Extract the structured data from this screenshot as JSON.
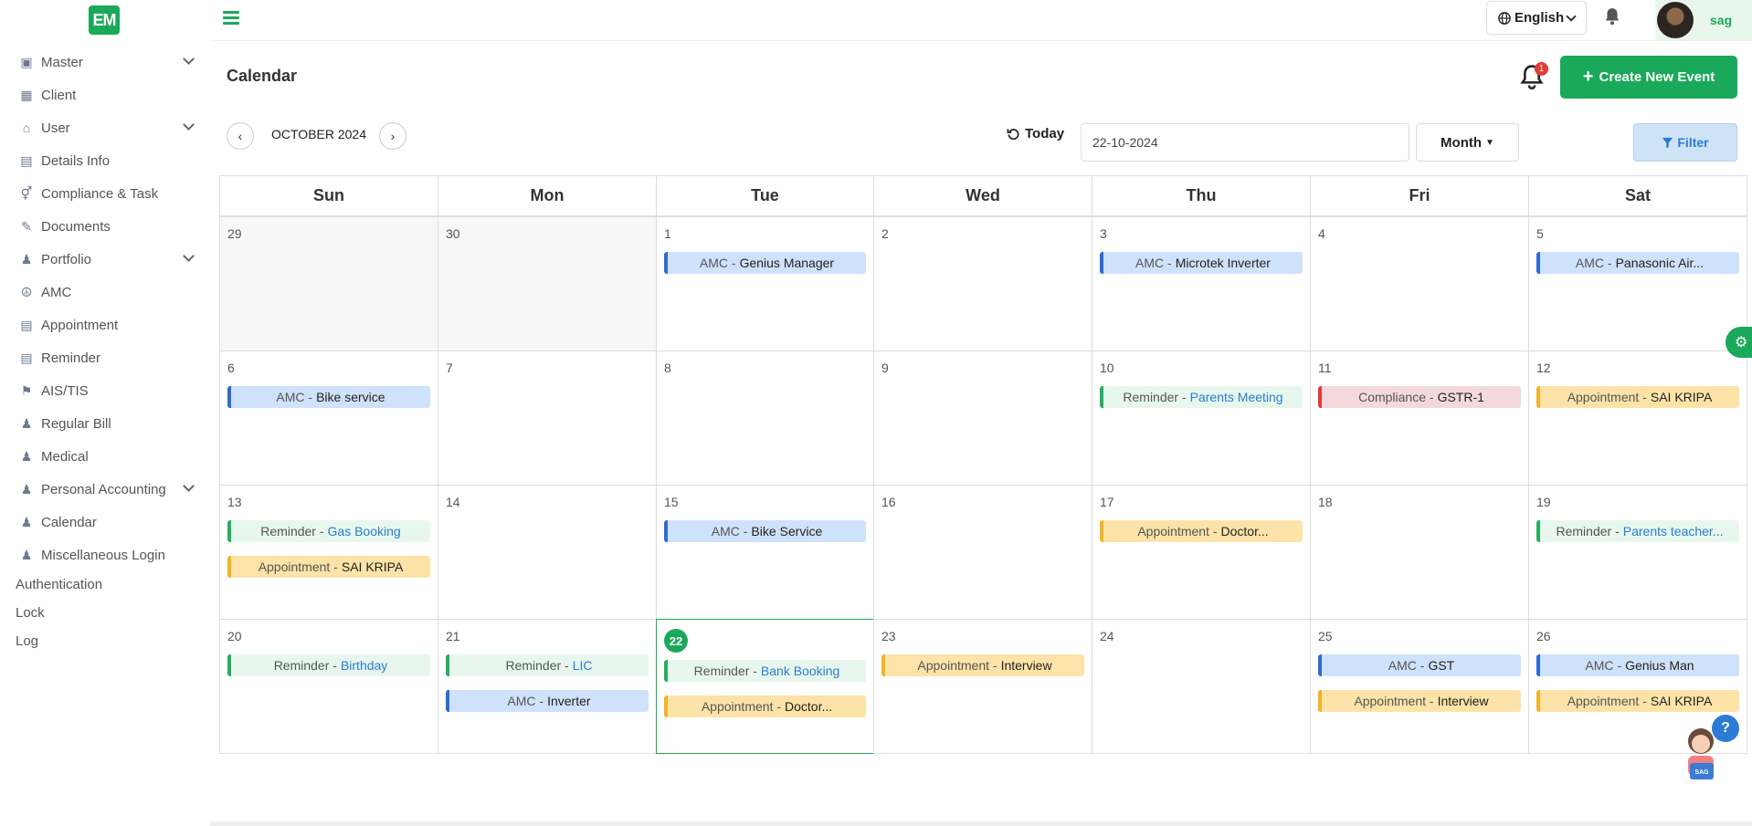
{
  "logo": {
    "text": "EM"
  },
  "sidebar": {
    "items": [
      {
        "label": "Master",
        "icon": "square-icon",
        "expandable": true
      },
      {
        "label": "Client",
        "icon": "building-icon",
        "expandable": false
      },
      {
        "label": "User",
        "icon": "user-home-icon",
        "expandable": true
      },
      {
        "label": "Details Info",
        "icon": "id-card-icon",
        "expandable": false
      },
      {
        "label": "Compliance & Task",
        "icon": "gender-icon",
        "expandable": false
      },
      {
        "label": "Documents",
        "icon": "edit-doc-icon",
        "expandable": false
      },
      {
        "label": "Portfolio",
        "icon": "user-icon",
        "expandable": true
      },
      {
        "label": "AMC",
        "icon": "peace-icon",
        "expandable": false
      },
      {
        "label": "Appointment",
        "icon": "doc-icon",
        "expandable": false
      },
      {
        "label": "Reminder",
        "icon": "reminder-icon",
        "expandable": false
      },
      {
        "label": "AIS/TIS",
        "icon": "tag-icon",
        "expandable": false
      },
      {
        "label": "Regular Bill",
        "icon": "user-edit-icon",
        "expandable": false
      },
      {
        "label": "Medical",
        "icon": "user-edit-icon",
        "expandable": false
      },
      {
        "label": "Personal Accounting",
        "icon": "user-edit-icon",
        "expandable": true
      },
      {
        "label": "Calendar",
        "icon": "user-edit-icon",
        "expandable": false
      },
      {
        "label": "Miscellaneous Login",
        "icon": "user-edit-icon",
        "expandable": false
      }
    ],
    "plain_items": [
      "Authentication",
      "Lock",
      "Log"
    ]
  },
  "header": {
    "language": "English",
    "username": "sag"
  },
  "page": {
    "title": "Calendar",
    "notification_count": "1",
    "create_button": "Create New Event",
    "month_label": "OCTOBER 2024",
    "today_label": "Today",
    "date_value": "22-10-2024",
    "view_label": "Month",
    "filter_label": "Filter"
  },
  "calendar": {
    "weekdays": [
      "Sun",
      "Mon",
      "Tue",
      "Wed",
      "Thu",
      "Fri",
      "Sat"
    ],
    "weeks": [
      [
        {
          "day": "29",
          "other": true,
          "events": []
        },
        {
          "day": "30",
          "other": true,
          "events": []
        },
        {
          "day": "1",
          "events": [
            {
              "type": "AMC -",
              "title": "Genius Manager",
              "cls": "amc"
            }
          ]
        },
        {
          "day": "2",
          "events": []
        },
        {
          "day": "3",
          "events": [
            {
              "type": "AMC -",
              "title": "Microtek Inverter",
              "cls": "amc"
            }
          ]
        },
        {
          "day": "4",
          "events": []
        },
        {
          "day": "5",
          "events": [
            {
              "type": "AMC -",
              "title": "Panasonic Air...",
              "cls": "amc"
            }
          ]
        }
      ],
      [
        {
          "day": "6",
          "events": [
            {
              "type": "AMC -",
              "title": "Bike service",
              "cls": "amc"
            }
          ]
        },
        {
          "day": "7",
          "events": []
        },
        {
          "day": "8",
          "events": []
        },
        {
          "day": "9",
          "events": []
        },
        {
          "day": "10",
          "events": [
            {
              "type": "Reminder -",
              "title": "Parents Meeting",
              "cls": "rem"
            }
          ]
        },
        {
          "day": "11",
          "events": [
            {
              "type": "Compliance -",
              "title": "GSTR-1",
              "cls": "comp"
            }
          ]
        },
        {
          "day": "12",
          "events": [
            {
              "type": "Appointment -",
              "title": "SAI KRIPA",
              "cls": "app"
            }
          ]
        }
      ],
      [
        {
          "day": "13",
          "events": [
            {
              "type": "Reminder -",
              "title": "Gas Booking",
              "cls": "rem"
            },
            {
              "type": "Appointment -",
              "title": "SAI KRIPA",
              "cls": "app"
            }
          ]
        },
        {
          "day": "14",
          "events": []
        },
        {
          "day": "15",
          "events": [
            {
              "type": "AMC -",
              "title": "Bike Service",
              "cls": "amc"
            }
          ]
        },
        {
          "day": "16",
          "events": []
        },
        {
          "day": "17",
          "events": [
            {
              "type": "Appointment -",
              "title": "Doctor...",
              "cls": "app"
            }
          ]
        },
        {
          "day": "18",
          "events": []
        },
        {
          "day": "19",
          "events": [
            {
              "type": "Reminder -",
              "title": "Parents teacher...",
              "cls": "rem"
            }
          ]
        }
      ],
      [
        {
          "day": "20",
          "events": [
            {
              "type": "Reminder -",
              "title": "Birthday",
              "cls": "rem"
            }
          ]
        },
        {
          "day": "21",
          "events": [
            {
              "type": "Reminder -",
              "title": "LIC",
              "cls": "rem"
            },
            {
              "type": "AMC -",
              "title": "Inverter",
              "cls": "amc"
            }
          ]
        },
        {
          "day": "22",
          "today": true,
          "events": [
            {
              "type": "Reminder -",
              "title": "Bank Booking",
              "cls": "rem"
            },
            {
              "type": "Appointment -",
              "title": "Doctor...",
              "cls": "app"
            }
          ]
        },
        {
          "day": "23",
          "events": [
            {
              "type": "Appointment -",
              "title": "Interview",
              "cls": "app"
            }
          ]
        },
        {
          "day": "24",
          "events": []
        },
        {
          "day": "25",
          "events": [
            {
              "type": "AMC -",
              "title": "GST",
              "cls": "amc"
            },
            {
              "type": "Appointment -",
              "title": "Interview",
              "cls": "app"
            }
          ]
        },
        {
          "day": "26",
          "events": [
            {
              "type": "AMC -",
              "title": "Genius Man",
              "cls": "amc"
            },
            {
              "type": "Appointment -",
              "title": "SAI KRIPA",
              "cls": "app"
            }
          ]
        }
      ]
    ]
  },
  "colors": {
    "brand": "#1aa95a",
    "amc": "#2e6bd0",
    "reminder": "#27ae60",
    "appointment": "#f0b429",
    "compliance": "#e53935"
  }
}
